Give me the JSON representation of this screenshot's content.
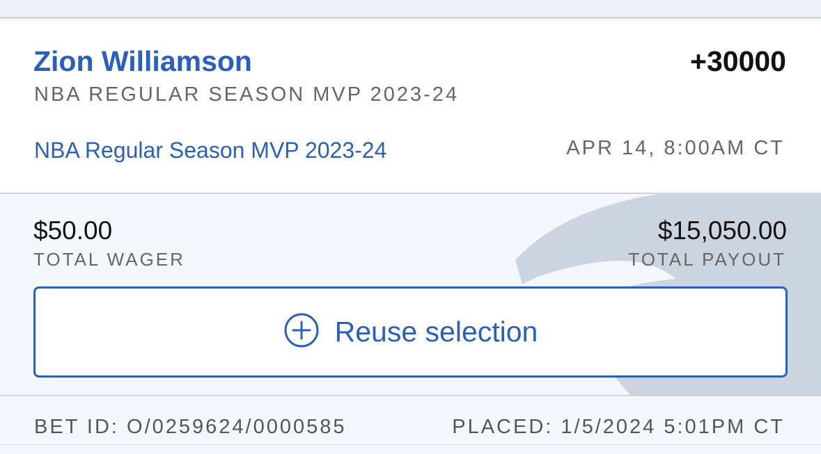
{
  "selection": {
    "player": "Zion Williamson",
    "odds": "+30000",
    "market": "NBA REGULAR SEASON MVP 2023-24",
    "event_link": "NBA Regular Season MVP 2023-24",
    "event_time": "APR 14, 8:00AM CT"
  },
  "wager": {
    "total_wager": "$50.00",
    "total_wager_label": "TOTAL WAGER",
    "total_payout": "$15,050.00",
    "total_payout_label": "TOTAL PAYOUT",
    "reuse_label": "Reuse selection",
    "reuse_icon": "plus-circle-icon"
  },
  "footer": {
    "bet_id": "BET ID: O/0259624/0000585",
    "placed": "PLACED: 1/5/2024 5:01PM CT"
  },
  "colors": {
    "accent": "#2b5fbd",
    "text_primary": "#111111",
    "text_muted": "#666666",
    "section_bg": "#f4f7fb",
    "watermark": "#ccd4e0"
  }
}
